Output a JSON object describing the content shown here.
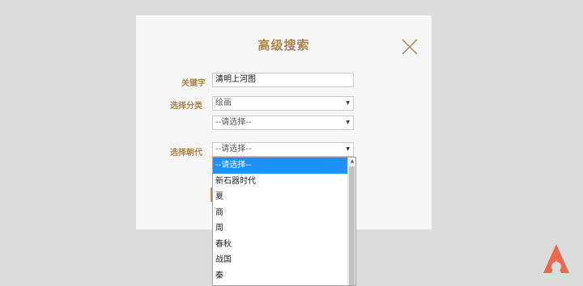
{
  "dialog": {
    "title": "高级搜索",
    "close_icon": "close-icon"
  },
  "form": {
    "keyword_label": "关键字",
    "keyword_value": "清明上河图",
    "category_label": "选择分类",
    "category_value": "绘画",
    "subcategory_value": "--请选择--",
    "dynasty_label": "选择朝代",
    "dynasty_value": "--请选择--"
  },
  "dynasty_options": [
    "--请选择--",
    "新石器时代",
    "夏",
    "商",
    "周",
    "春秋",
    "战国",
    "秦"
  ],
  "colors": {
    "accent": "#a9824d",
    "selected_option": "#1e90ff",
    "logo": "#e86b4f"
  }
}
